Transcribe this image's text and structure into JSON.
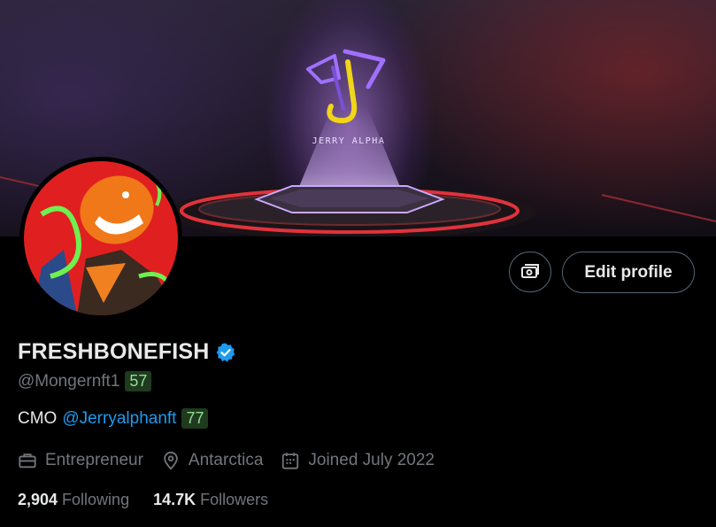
{
  "banner": {
    "brand_text": "JERRY ALPHA"
  },
  "profile": {
    "display_name": "FRESHBONEFISH",
    "verified_icon": "verified-badge-icon",
    "handle": "@Mongernft1",
    "handle_badge": "57",
    "bio_prefix": "CMO",
    "bio_mention": "@Jerryalphanft",
    "bio_badge": "77",
    "profession": "Entrepreneur",
    "location": "Antarctica",
    "joined": "Joined July 2022"
  },
  "actions": {
    "edit_profile_label": "Edit profile",
    "secondary_icon": "money-icon"
  },
  "stats": {
    "following_count": "2,904",
    "following_label": "Following",
    "followers_count": "14.7K",
    "followers_label": "Followers"
  },
  "colors": {
    "background": "#000000",
    "link": "#1d9bf0",
    "muted": "#71767b",
    "verified": "#1d9bf0",
    "badge_bg": "#1f3a1f",
    "badge_text": "#8ee08e"
  }
}
